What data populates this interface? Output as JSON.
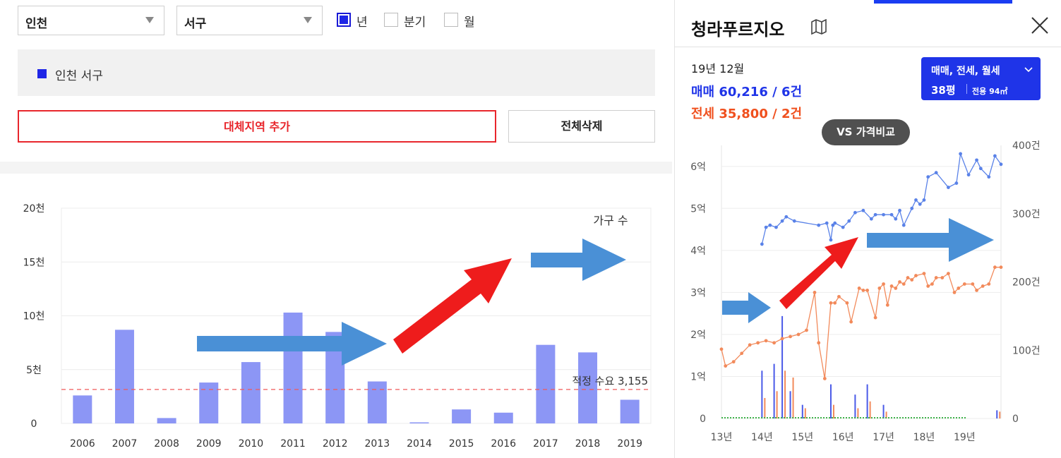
{
  "filters": {
    "region": "인천",
    "district": "서구",
    "periods": [
      {
        "label": "년",
        "checked": true
      },
      {
        "label": "분기",
        "checked": false
      },
      {
        "label": "월",
        "checked": false
      }
    ]
  },
  "selected_region_label": "인천 서구",
  "buttons": {
    "add_region": "대체지역 추가",
    "delete_all": "전체삭제"
  },
  "colors": {
    "bar": "#8c96f5",
    "accent_red": "#e8262c",
    "blue_arrow": "#4a90d6",
    "sale_line": "#5a82e8",
    "jeonse_line": "#f28a5b",
    "brand_blue": "#1f34e8"
  },
  "chart_data": [
    {
      "type": "bar",
      "categories": [
        "2006",
        "2007",
        "2008",
        "2009",
        "2010",
        "2011",
        "2012",
        "2013",
        "2014",
        "2015",
        "2016",
        "2017",
        "2018",
        "2019"
      ],
      "values": [
        2600,
        8700,
        500,
        3800,
        5700,
        10300,
        8500,
        3900,
        100,
        1300,
        1000,
        7300,
        6600,
        2200
      ],
      "ylim": [
        0,
        20000
      ],
      "yticks": [
        {
          "value": 0,
          "label": "0"
        },
        {
          "value": 5000,
          "label": "5천"
        },
        {
          "value": 10000,
          "label": "10천"
        },
        {
          "value": 15000,
          "label": "15천"
        },
        {
          "value": 20000,
          "label": "20천"
        }
      ],
      "series_label": "가구 수",
      "reference_line": {
        "value": 3155,
        "label": "적정 수요 3,155"
      },
      "grid": true
    },
    {
      "type": "line",
      "x_labels": [
        "13년",
        "14년",
        "15년",
        "16년",
        "17년",
        "18년",
        "19년"
      ],
      "xlim": [
        2013,
        2019.9
      ],
      "ylim": [
        0,
        6.5
      ],
      "yticks_left": [
        "0",
        "1억",
        "2억",
        "3억",
        "4억",
        "5억",
        "6억"
      ],
      "yticks_right": [
        "0",
        "100건",
        "200건",
        "300건",
        "400건"
      ],
      "series": [
        {
          "key": "sale",
          "points": [
            [
              2014.0,
              4.15
            ],
            [
              2014.1,
              4.55
            ],
            [
              2014.2,
              4.6
            ],
            [
              2014.35,
              4.55
            ],
            [
              2014.5,
              4.7
            ],
            [
              2014.6,
              4.8
            ],
            [
              2014.8,
              4.7
            ],
            [
              2015.4,
              4.6
            ],
            [
              2015.6,
              4.65
            ],
            [
              2015.7,
              4.25
            ],
            [
              2015.75,
              4.6
            ],
            [
              2015.8,
              4.65
            ],
            [
              2016.0,
              4.55
            ],
            [
              2016.15,
              4.7
            ],
            [
              2016.3,
              4.9
            ],
            [
              2016.5,
              4.95
            ],
            [
              2016.7,
              4.75
            ],
            [
              2016.8,
              4.85
            ],
            [
              2017.0,
              4.85
            ],
            [
              2017.2,
              4.85
            ],
            [
              2017.3,
              4.75
            ],
            [
              2017.4,
              4.95
            ],
            [
              2017.5,
              4.6
            ],
            [
              2017.7,
              5.0
            ],
            [
              2017.8,
              5.2
            ],
            [
              2017.9,
              5.1
            ],
            [
              2018.0,
              5.2
            ],
            [
              2018.1,
              5.75
            ],
            [
              2018.3,
              5.85
            ],
            [
              2018.6,
              5.5
            ],
            [
              2018.8,
              5.6
            ],
            [
              2018.9,
              6.3
            ],
            [
              2019.1,
              5.8
            ],
            [
              2019.3,
              6.15
            ],
            [
              2019.4,
              5.95
            ],
            [
              2019.6,
              5.75
            ],
            [
              2019.75,
              6.25
            ],
            [
              2019.9,
              6.05
            ]
          ]
        },
        {
          "key": "jeonse",
          "points": [
            [
              2013.0,
              1.65
            ],
            [
              2013.1,
              1.25
            ],
            [
              2013.3,
              1.35
            ],
            [
              2013.5,
              1.55
            ],
            [
              2013.7,
              1.75
            ],
            [
              2013.9,
              1.8
            ],
            [
              2014.1,
              1.85
            ],
            [
              2014.3,
              1.8
            ],
            [
              2014.5,
              1.9
            ],
            [
              2014.7,
              1.95
            ],
            [
              2014.9,
              2.0
            ],
            [
              2015.1,
              2.1
            ],
            [
              2015.3,
              3.0
            ],
            [
              2015.4,
              1.8
            ],
            [
              2015.55,
              0.95
            ],
            [
              2015.7,
              2.75
            ],
            [
              2015.8,
              2.75
            ],
            [
              2015.9,
              2.9
            ],
            [
              2016.1,
              2.75
            ],
            [
              2016.2,
              2.3
            ],
            [
              2016.4,
              3.1
            ],
            [
              2016.5,
              3.05
            ],
            [
              2016.6,
              3.05
            ],
            [
              2016.8,
              2.4
            ],
            [
              2016.9,
              3.1
            ],
            [
              2017.0,
              3.2
            ],
            [
              2017.1,
              2.7
            ],
            [
              2017.2,
              3.15
            ],
            [
              2017.3,
              3.1
            ],
            [
              2017.4,
              3.25
            ],
            [
              2017.5,
              3.2
            ],
            [
              2017.6,
              3.35
            ],
            [
              2017.7,
              3.3
            ],
            [
              2017.8,
              3.4
            ],
            [
              2018.0,
              3.45
            ],
            [
              2018.1,
              3.15
            ],
            [
              2018.2,
              3.2
            ],
            [
              2018.3,
              3.35
            ],
            [
              2018.45,
              3.35
            ],
            [
              2018.6,
              3.45
            ],
            [
              2018.75,
              3.0
            ],
            [
              2018.85,
              3.1
            ],
            [
              2019.0,
              3.2
            ],
            [
              2019.2,
              3.2
            ],
            [
              2019.3,
              3.05
            ],
            [
              2019.45,
              3.15
            ],
            [
              2019.6,
              3.2
            ],
            [
              2019.75,
              3.6
            ],
            [
              2019.9,
              3.6
            ]
          ]
        }
      ],
      "volume_bars": [
        {
          "x": 2014.0,
          "sale": 70,
          "jeonse": 30
        },
        {
          "x": 2014.3,
          "sale": 80,
          "jeonse": 40
        },
        {
          "x": 2014.5,
          "sale": 150,
          "jeonse": 70
        },
        {
          "x": 2014.7,
          "sale": 40,
          "jeonse": 60
        },
        {
          "x": 2015.0,
          "sale": 20,
          "jeonse": 15
        },
        {
          "x": 2015.7,
          "sale": 50,
          "jeonse": 20
        },
        {
          "x": 2016.3,
          "sale": 35,
          "jeonse": 15
        },
        {
          "x": 2016.6,
          "sale": 50,
          "jeonse": 25
        },
        {
          "x": 2017.0,
          "sale": 20,
          "jeonse": 10
        },
        {
          "x": 2019.8,
          "sale": 12,
          "jeonse": 10
        }
      ]
    }
  ],
  "apartment": {
    "name": "청라푸르지오",
    "date": "19년 12월",
    "sale_label": "매매 60,216 / 6건",
    "jeonse_label": "전세 35,800 / 2건",
    "type_label": "매매, 전세, 월세",
    "size_label": "38평",
    "area_label": "전용 94㎡",
    "compare_button": "VS 가격비교"
  }
}
